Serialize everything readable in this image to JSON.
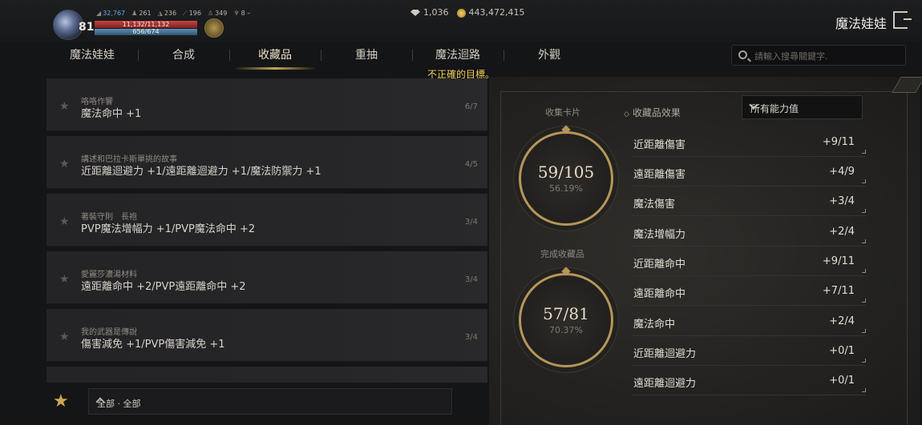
{
  "player": {
    "level": "81",
    "combat_power": "32,767",
    "stat_a": "261",
    "stat_b": "236",
    "stat_c": "196",
    "stat_d": "349",
    "stat_e": "8 –",
    "hp": "11,132/11,132",
    "mp": "656/674"
  },
  "currency": {
    "gems": "1,036",
    "gold": "443,472,415"
  },
  "header": {
    "title": "魔法娃娃"
  },
  "tabs": [
    "魔法娃娃",
    "合成",
    "收藏品",
    "重抽",
    "魔法迴路",
    "外觀"
  ],
  "active_tab": "收藏品",
  "search": {
    "placeholder": "請輸入搜尋關鍵字."
  },
  "toast": "不正確的目標。",
  "collections": [
    {
      "title": "咯咯作響",
      "effect": "魔法命中 +1",
      "count": "6/7"
    },
    {
      "title": "講述和巴拉卡斯單挑的故事",
      "effect": "近距離迴避力 +1/遠距離迴避力 +1/魔法防禦力 +1",
      "count": "4/5"
    },
    {
      "title": "著裝守則　長袍",
      "effect": "PVP魔法增幅力 +1/PVP魔法命中 +2",
      "count": "3/4"
    },
    {
      "title": "愛麗莎濃湯材料",
      "effect": "遠距離命中 +2/PVP遠距離命中 +2",
      "count": "3/4"
    },
    {
      "title": "我的武器是傳說",
      "effect": "傷害減免 +1/PVP傷害減免 +1",
      "count": "3/4"
    }
  ],
  "filter": {
    "label": "全部 · 全部"
  },
  "summary": {
    "cards_label": "收集卡片",
    "cards_value": "59/105",
    "cards_pct": "56.19%",
    "complete_label": "完成收藏品",
    "complete_value": "57/81",
    "complete_pct": "70.37%"
  },
  "effects": {
    "label": "收藏品效果",
    "dropdown_value": "所有能力值",
    "rows": [
      {
        "name": "近距離傷害",
        "value": "+9/11"
      },
      {
        "name": "遠距離傷害",
        "value": "+4/9"
      },
      {
        "name": "魔法傷害",
        "value": "+3/4"
      },
      {
        "name": "魔法增幅力",
        "value": "+2/4"
      },
      {
        "name": "近距離命中",
        "value": "+9/11"
      },
      {
        "name": "遠距離命中",
        "value": "+7/11"
      },
      {
        "name": "魔法命中",
        "value": "+2/4"
      },
      {
        "name": "近距離迴避力",
        "value": "+0/1"
      },
      {
        "name": "遠距離迴避力",
        "value": "+0/1"
      }
    ]
  }
}
